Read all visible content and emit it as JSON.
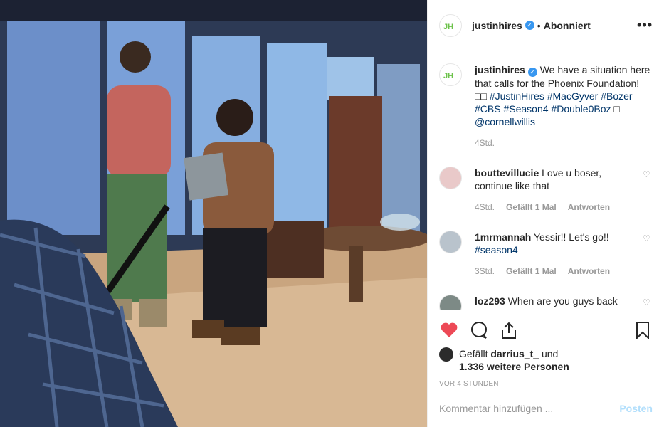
{
  "post": {
    "image_alt": "",
    "author": "justinhires",
    "follow_state": "Abonniert",
    "separator": "•",
    "more_label": "•••"
  },
  "caption": {
    "author": "justinhires",
    "text_before": "We have a situation here that calls for the Phoenix Foundation! ",
    "emoji_placeholder": "□□",
    "hashtags": [
      "#JustinHires",
      "#MacGyver",
      "#Bozer",
      "#CBS",
      "#Season4",
      "#Double0Boz"
    ],
    "emoji2": "□",
    "mention": "@cornellwillis",
    "time": "4Std."
  },
  "comments": [
    {
      "user": "bouttevillucie",
      "text": "Love u boser, continue like that",
      "time": "4Std.",
      "likes": "Gefällt 1 Mal",
      "reply": "Antworten"
    },
    {
      "user": "1mrmannah",
      "text": "Yessir!! Let's go!! ",
      "tag": "#season4",
      "time": "3Std.",
      "likes": "Gefällt 1 Mal",
      "reply": "Antworten"
    },
    {
      "user": "loz293",
      "text": "When are you guys back"
    }
  ],
  "likes": {
    "prefix": "Gefällt ",
    "user": "darrius_t_",
    "middle": " und",
    "count_text": "1.336 weitere Personen"
  },
  "timestamp": "VOR 4 STUNDEN",
  "comment_box": {
    "placeholder": "Kommentar hinzufügen ...",
    "post_label": "Posten"
  },
  "colors": {
    "like_red": "#ed4956",
    "link_blue": "#003569",
    "verified_blue": "#3897f0",
    "post_disabled": "#b2dffc"
  }
}
